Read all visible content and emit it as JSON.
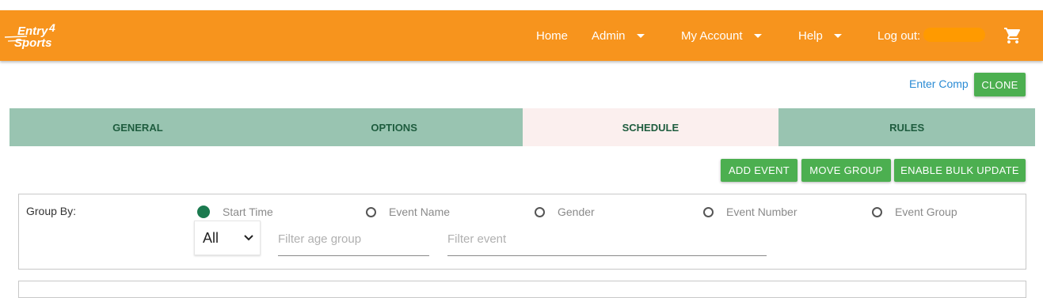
{
  "brand": {
    "logo_alt": "Entry4Sports",
    "logo_line1": "Entry",
    "logo_numeral": "4",
    "logo_line2": "Sports"
  },
  "nav": {
    "home": "Home",
    "admin": "Admin",
    "my_account": "My Account",
    "help": "Help",
    "logout": "Log out:",
    "cart_icon": "shopping-cart-icon"
  },
  "actions": {
    "enter_comp": "Enter Comp",
    "clone": "CLONE",
    "add_event": "ADD EVENT",
    "move_group": "MOVE GROUP",
    "enable_bulk_update": "ENABLE BULK UPDATE"
  },
  "tabs": [
    {
      "label": "GENERAL",
      "active": false
    },
    {
      "label": "OPTIONS",
      "active": false
    },
    {
      "label": "SCHEDULE",
      "active": true
    },
    {
      "label": "RULES",
      "active": false
    }
  ],
  "filters": {
    "group_by_label": "Group By:",
    "group_by_options": [
      "Start Time",
      "Event Name",
      "Gender",
      "Event Number",
      "Event Group"
    ],
    "selected_group_by": "Start Time",
    "gender_select_value": "All",
    "age_group_placeholder": "Filter age group",
    "event_placeholder": "Filter event"
  },
  "colors": {
    "navbar": "#f7941d",
    "button_green": "#4caf50",
    "tab_bg": "#99c4b1",
    "tab_active_bg": "#fbefee",
    "link_blue": "#2a8bd4"
  }
}
